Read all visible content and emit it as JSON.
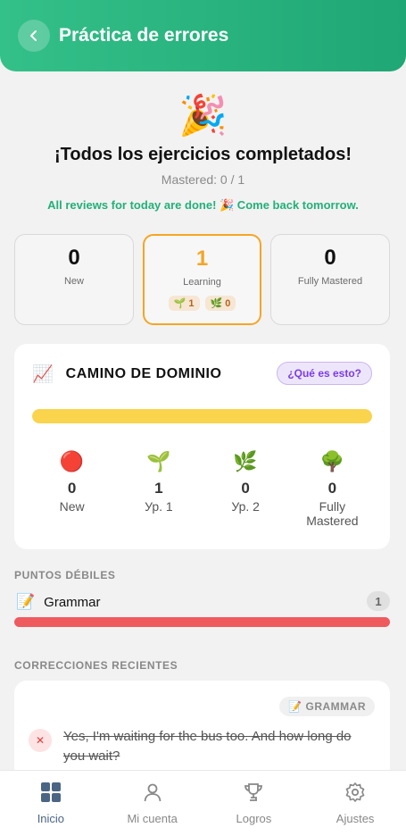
{
  "header": {
    "title": "Práctica de errores"
  },
  "hero": {
    "emoji": "🎉",
    "title": "¡Todos los ejercicios completados!",
    "subtitle": "Mastered: 0 / 1",
    "note": "All reviews for today are done! 🎉 Come back tomorrow."
  },
  "stats": [
    {
      "value": "0",
      "label": "New"
    },
    {
      "value": "1",
      "label": "Learning",
      "chips": [
        {
          "icon": "🌱",
          "count": "1"
        },
        {
          "icon": "🌿",
          "count": "0"
        }
      ]
    },
    {
      "value": "0",
      "label": "Fully Mastered"
    }
  ],
  "mastery": {
    "icon": "📈",
    "title": "CAMINO DE DOMINIO",
    "help_label": "¿Qué es esto?",
    "progress_fraction": 1.0,
    "levels": [
      {
        "icon": "🔴",
        "count": "0",
        "label": "New"
      },
      {
        "icon": "🌱",
        "count": "1",
        "label": "Ур. 1"
      },
      {
        "icon": "🌿",
        "count": "0",
        "label": "Ур. 2"
      },
      {
        "icon": "🌳",
        "count": "0",
        "label": "Fully Mastered"
      }
    ]
  },
  "weak_points": {
    "label": "PUNTOS DÉBILES",
    "items": [
      {
        "icon": "📝",
        "name": "Grammar",
        "count": "1"
      }
    ]
  },
  "corrections": {
    "label": "CORRECCIONES RECIENTES",
    "items": [
      {
        "tag": "📝 GRAMMAR",
        "wrong": "Yes, I'm waiting for the bus too. And how long do you wait?"
      }
    ]
  },
  "nav": {
    "items": [
      {
        "label": "Inicio",
        "icon": "grid-icon",
        "active": true
      },
      {
        "label": "Mi cuenta",
        "icon": "user-icon"
      },
      {
        "label": "Logros",
        "icon": "trophy-icon"
      },
      {
        "label": "Ajustes",
        "icon": "gear-icon"
      }
    ]
  },
  "colors": {
    "brand": "#22b07a",
    "learning_accent": "#f5a524",
    "weak_bar": "#ef5a5f",
    "progress": "#f9d44c",
    "help_purple": "#7c3aed"
  }
}
